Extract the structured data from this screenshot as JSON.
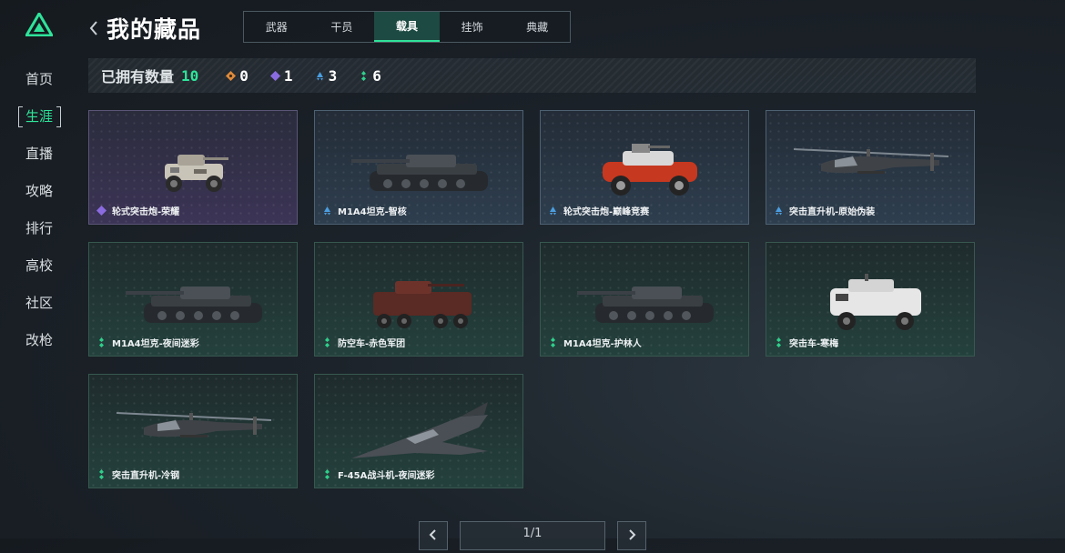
{
  "header": {
    "title": "我的藏品"
  },
  "sidebar": {
    "items": [
      {
        "label": "首页"
      },
      {
        "label": "生涯"
      },
      {
        "label": "直播"
      },
      {
        "label": "攻略"
      },
      {
        "label": "排行"
      },
      {
        "label": "高校"
      },
      {
        "label": "社区"
      },
      {
        "label": "改枪"
      }
    ],
    "active_index": 1
  },
  "tabs": [
    {
      "label": "武器"
    },
    {
      "label": "干员"
    },
    {
      "label": "载具"
    },
    {
      "label": "挂饰"
    },
    {
      "label": "典藏"
    }
  ],
  "active_tab": 2,
  "summary": {
    "label": "已拥有数量",
    "total": "10",
    "orange": "0",
    "purple": "1",
    "blue": "3",
    "green": "6"
  },
  "items": [
    {
      "name": "轮式突击炮-荣耀",
      "rarity": "purple",
      "icon": "wheeled-assault-gun"
    },
    {
      "name": "M1A4坦克-智核",
      "rarity": "blue",
      "icon": "tank"
    },
    {
      "name": "轮式突击炮-巅峰竞赛",
      "rarity": "blue",
      "icon": "buggy"
    },
    {
      "name": "突击直升机-原始伪装",
      "rarity": "blue",
      "icon": "helicopter"
    },
    {
      "name": "M1A4坦克-夜间迷彩",
      "rarity": "green",
      "icon": "tank"
    },
    {
      "name": "防空车-赤色军团",
      "rarity": "green",
      "icon": "apc"
    },
    {
      "name": "M1A4坦克-护林人",
      "rarity": "green",
      "icon": "tank"
    },
    {
      "name": "突击车-寒梅",
      "rarity": "green",
      "icon": "armored-car"
    },
    {
      "name": "突击直升机-冷钢",
      "rarity": "green",
      "icon": "helicopter"
    },
    {
      "name": "F-45A战斗机-夜间迷彩",
      "rarity": "green",
      "icon": "jet"
    }
  ],
  "pagination": {
    "text": "1/1"
  },
  "colors": {
    "accent": "#2fe39a",
    "purple": "#8b6be0",
    "blue": "#4a9ee0",
    "green": "#2fd08c",
    "orange": "#e08a3a"
  }
}
